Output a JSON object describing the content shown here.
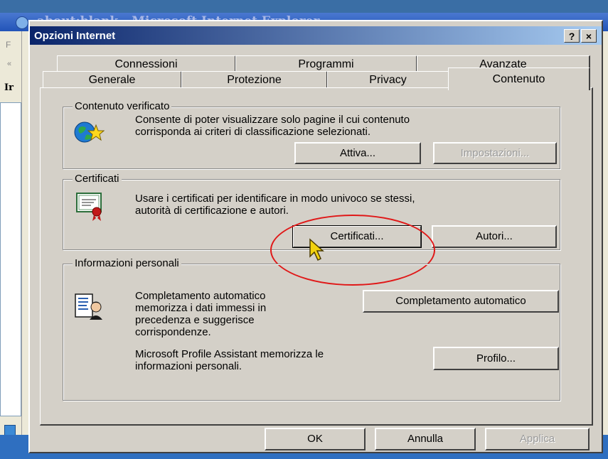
{
  "ie": {
    "window_title": "about:blank - Microsoft Internet Explorer",
    "left_text": "Ir",
    "left_menu_letter": "F",
    "left_arrow": "«"
  },
  "dialog": {
    "title": "Opzioni Internet",
    "help_label": "?",
    "close_label": "×"
  },
  "tabs": {
    "row1": [
      "Connessioni",
      "Programmi",
      "Avanzate"
    ],
    "row2": [
      "Generale",
      "Protezione",
      "Privacy",
      "Contenuto"
    ],
    "selected": "Contenuto"
  },
  "content_advisor": {
    "group_label": "Contenuto verificato",
    "description_line1": "Consente di poter visualizzare solo pagine il cui contenuto",
    "description_line2": "corrisponda ai criteri di classificazione selezionati.",
    "enable_button": "Attiva...",
    "settings_button": "Impostazioni..."
  },
  "certificates": {
    "group_label": "Certificati",
    "description_line1": "Usare i certificati per identificare in modo univoco se stessi,",
    "description_line2": "autorità di certificazione e autori.",
    "certificates_button": "Certificati...",
    "publishers_button": "Autori..."
  },
  "personal_info": {
    "group_label": "Informazioni personali",
    "autocomplete_line1": "Completamento automatico",
    "autocomplete_line2": "memorizza i dati immessi in",
    "autocomplete_line3": "precedenza e suggerisce",
    "autocomplete_line4": "corrispondenze.",
    "autocomplete_button": "Completamento automatico",
    "profile_line1": "Microsoft Profile Assistant memorizza le",
    "profile_line2": "informazioni personali.",
    "profile_button": "Profilo..."
  },
  "footer": {
    "ok": "OK",
    "cancel": "Annulla",
    "apply": "Applica"
  },
  "colors": {
    "highlight_ellipse": "#e01818",
    "title_bar_start": "#0a246a",
    "title_bar_end": "#a6caf0",
    "dialog_face": "#d4d0c8"
  }
}
